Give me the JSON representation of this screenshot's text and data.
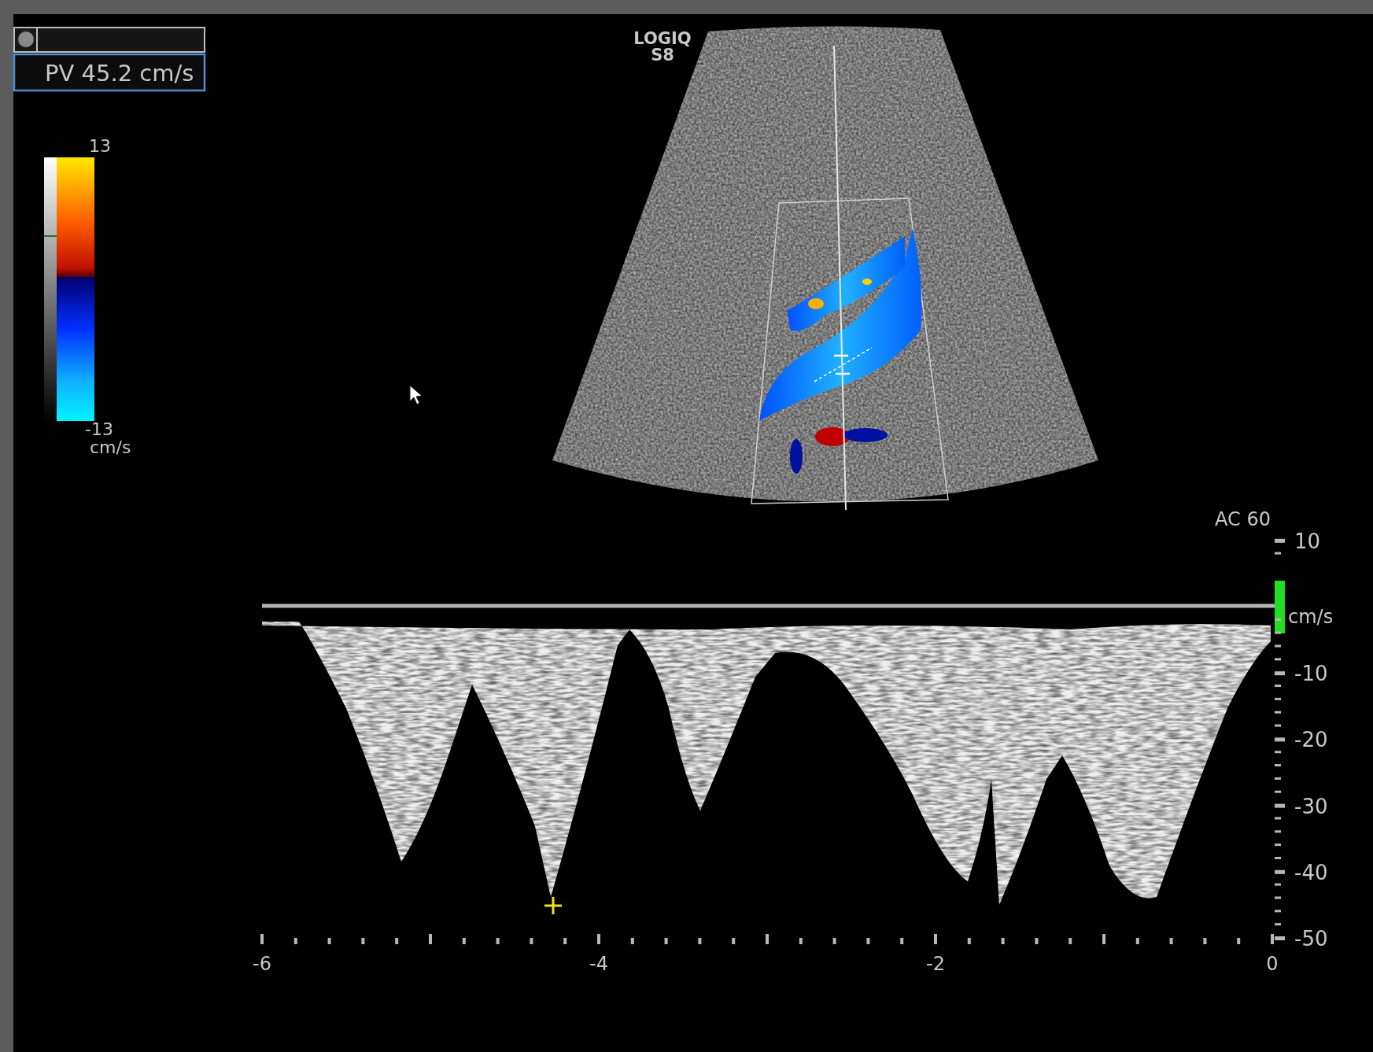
{
  "measurement_panel": {
    "measurement": "PV 45.2 cm/s"
  },
  "color_scale": {
    "max": "13",
    "min": "-13",
    "unit": "cm/s"
  },
  "image": {
    "brand": "LOGIQ",
    "model": "S8"
  },
  "spectrum": {
    "scale_label": "AC 60",
    "unit": "cm/s",
    "velocity_ticks": [
      "10",
      "-10",
      "-20",
      "-30",
      "-40",
      "-50"
    ],
    "time_ticks": [
      "-6",
      "-4",
      "-2",
      "0"
    ]
  }
}
